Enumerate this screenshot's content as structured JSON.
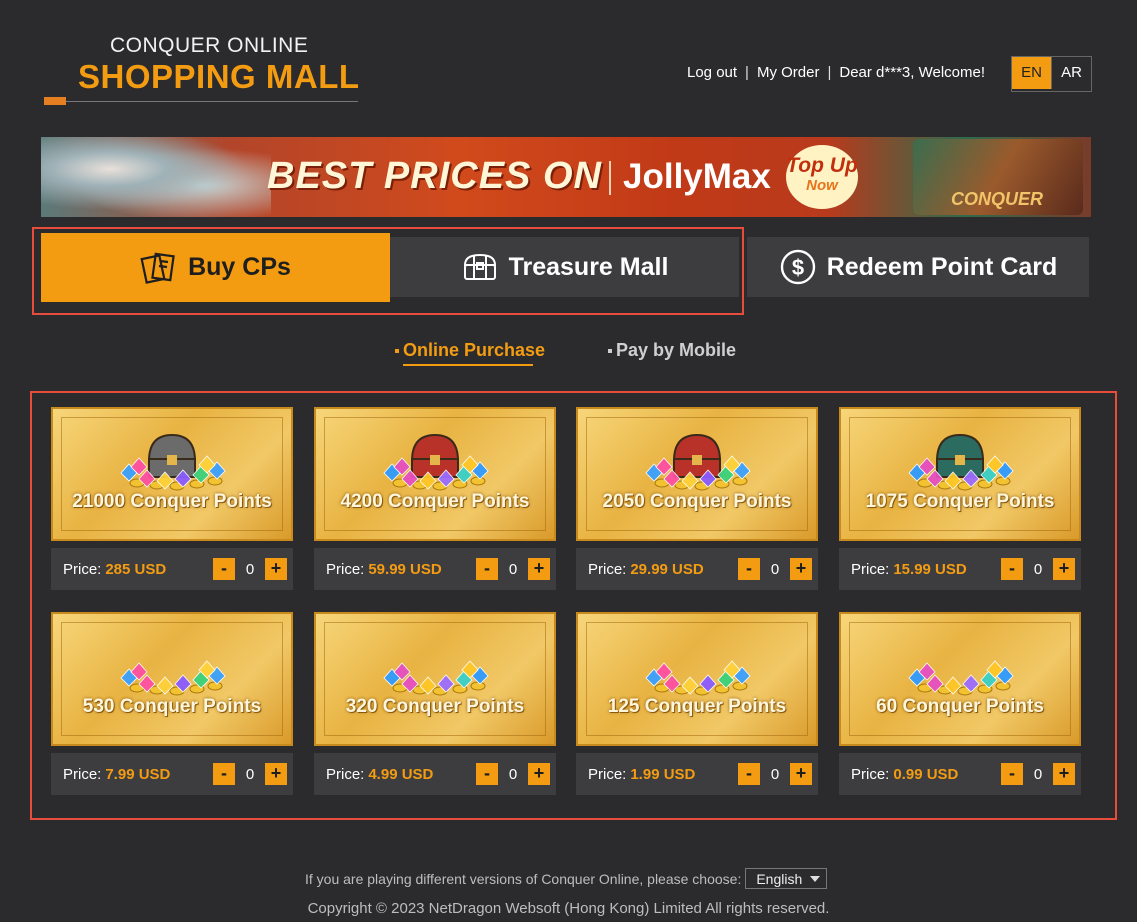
{
  "logo": {
    "line1": "CONQUER ONLINE",
    "line2": "SHOPPING MALL"
  },
  "header": {
    "logout": "Log out",
    "my_order": "My Order",
    "separator": "|",
    "welcome": "Dear d***3, Welcome!",
    "lang_en": "EN",
    "lang_ar": "AR"
  },
  "banner": {
    "headline": "BEST PRICES ON",
    "brand": "JollyMax",
    "cta_line1": "Top Up",
    "cta_line2": "Now",
    "game_logo": "CONQUER"
  },
  "tabs": [
    {
      "label": "Buy CPs",
      "icon": "ticket-icon",
      "active": true
    },
    {
      "label": "Treasure Mall",
      "icon": "treasure-chest-icon",
      "active": false
    },
    {
      "label": "Redeem Point Card",
      "icon": "dollar-circle-icon",
      "active": false
    }
  ],
  "subtabs": [
    {
      "label": "Online Purchase",
      "active": true
    },
    {
      "label": "Pay by Mobile",
      "active": false
    }
  ],
  "price_label": "Price:",
  "minus": "-",
  "plus": "+",
  "products": [
    {
      "points": "21000 Conquer Points",
      "price": "285 USD",
      "qty": "0",
      "chest": "gray-chest"
    },
    {
      "points": "4200 Conquer Points",
      "price": "59.99 USD",
      "qty": "0",
      "chest": "red-chest"
    },
    {
      "points": "2050 Conquer Points",
      "price": "29.99 USD",
      "qty": "0",
      "chest": "red-chest"
    },
    {
      "points": "1075 Conquer Points",
      "price": "15.99 USD",
      "qty": "0",
      "chest": "green-chest"
    },
    {
      "points": "530 Conquer Points",
      "price": "7.99 USD",
      "qty": "0",
      "chest": "gem-pile"
    },
    {
      "points": "320 Conquer Points",
      "price": "4.99 USD",
      "qty": "0",
      "chest": "gem-pile"
    },
    {
      "points": "125 Conquer Points",
      "price": "1.99 USD",
      "qty": "0",
      "chest": "gem-pile"
    },
    {
      "points": "60 Conquer Points",
      "price": "0.99 USD",
      "qty": "0",
      "chest": "gem-pile"
    }
  ],
  "footer": {
    "version_prompt": "If you are playing different versions of Conquer Online, please choose:",
    "version_selected": "English",
    "copyright": "Copyright © 2023 NetDragon Websoft (Hong Kong) Limited All rights reserved."
  },
  "colors": {
    "accent": "#f39c12",
    "background": "#2b2b2e",
    "panel": "#3d3d40",
    "highlight_outline": "#e74c3c"
  }
}
